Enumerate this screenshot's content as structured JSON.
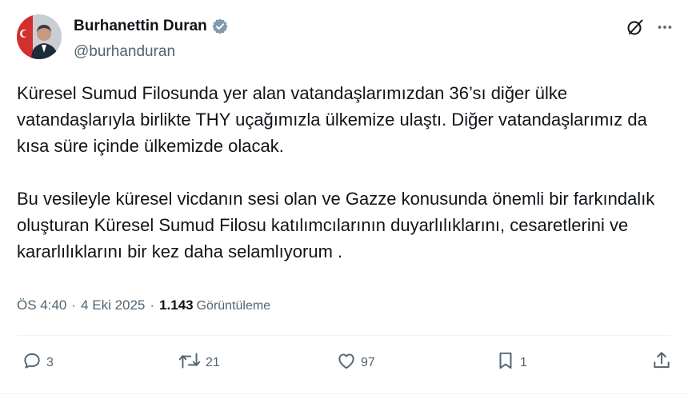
{
  "author": {
    "display_name": "Burhanettin Duran",
    "handle": "@burhanduran",
    "verified_color": "#829aab"
  },
  "tweet": {
    "paragraphs": [
      "Küresel Sumud Filosunda yer alan vatandaşlarımızdan 36’sı diğer ülke vatandaşlarıyla birlikte THY uçağımızla ülkemize ulaştı. Diğer vatandaşlarımız da kısa süre içinde ülkemizde olacak.",
      "Bu vesileyle küresel vicdanın sesi olan ve Gazze konusunda önemli bir farkındalık oluşturan Küresel Sumud Filosu katılımcılarının duyarlılıklarını, cesaretlerini ve kararlılıklarını bir kez daha selamlıyorum ."
    ],
    "time": "ÖS 4:40",
    "date": "4 Eki 2025",
    "separator": "·",
    "views_count": "1.143",
    "views_label": "Görüntüleme"
  },
  "actions": {
    "reply_count": "3",
    "retweet_count": "21",
    "like_count": "97",
    "bookmark_count": "1"
  },
  "icons": [
    "verified-badge-icon",
    "grok-icon",
    "more-icon",
    "reply-icon",
    "retweet-icon",
    "like-icon",
    "bookmark-icon",
    "share-icon"
  ],
  "colors": {
    "text": "#0f1419",
    "secondary": "#536471"
  }
}
